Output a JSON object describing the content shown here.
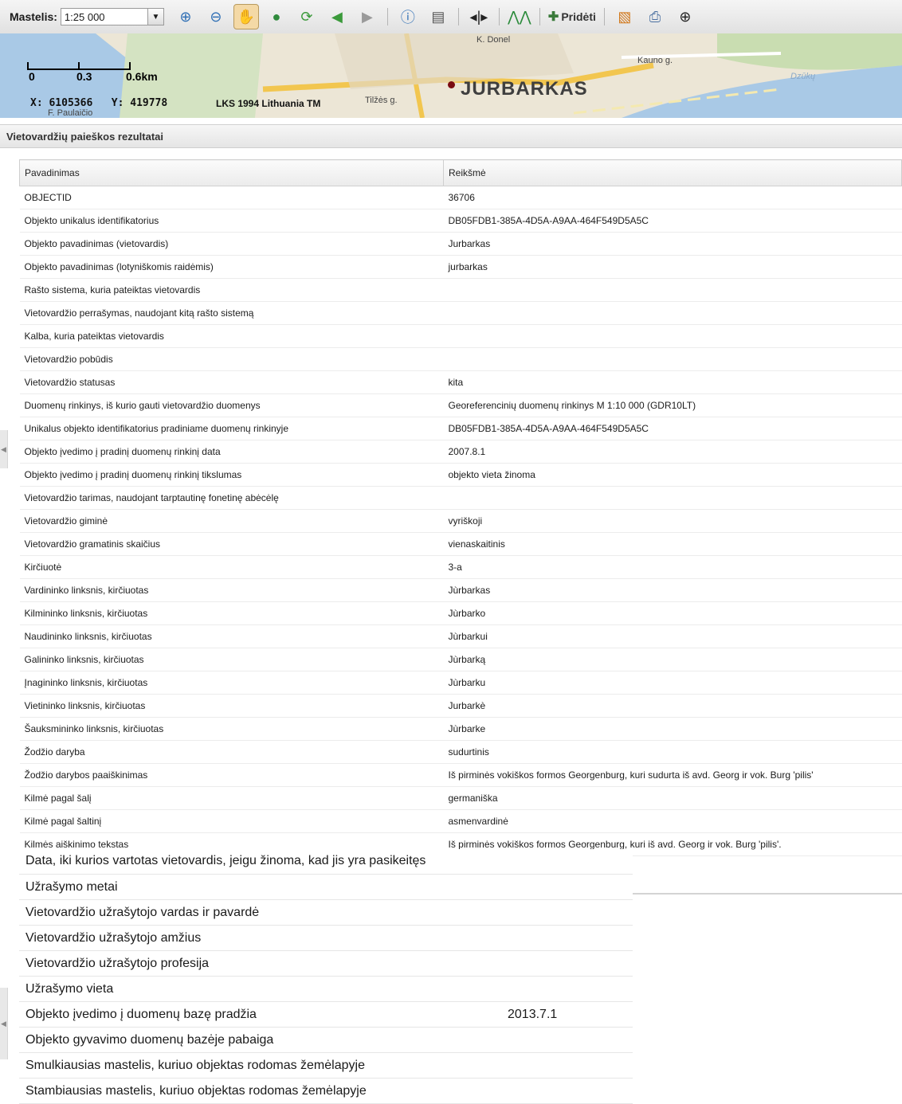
{
  "toolbar": {
    "scale_label": "Mastelis:",
    "scale_value": "1:25 000",
    "add_label": "Pridėti",
    "icons": [
      "zoom-in-icon",
      "zoom-out-icon",
      "pan-hand-icon",
      "globe-icon",
      "refresh-icon",
      "back-arrow-icon",
      "forward-arrow-icon",
      "info-icon",
      "print-icon",
      "split-view-icon",
      "elevation-profile-icon",
      "add-icon",
      "layers-icon",
      "print-map-icon",
      "locate-target-icon"
    ]
  },
  "map": {
    "town": "JURBARKAS",
    "streets": [
      "K. Donel",
      "Kauno g.",
      "Dzūkų",
      "Tilžės g.",
      "F. Paulaičio"
    ],
    "scale_ticks": [
      "0",
      "0.3",
      "0.6km"
    ],
    "coord_x_label": "X:",
    "coord_x": "6105366",
    "coord_y_label": "Y:",
    "coord_y": "419778",
    "projection": "LKS 1994 Lithuania TM"
  },
  "panel": {
    "title": "Vietovardžių paieškos rezultatai",
    "col_name": "Pavadinimas",
    "col_value": "Reikšmė",
    "rows": [
      {
        "k": "OBJECTID",
        "v": "36706"
      },
      {
        "k": "Objekto unikalus identifikatorius",
        "v": "DB05FDB1-385A-4D5A-A9AA-464F549D5A5C"
      },
      {
        "k": "Objekto pavadinimas (vietovardis)",
        "v": "Jurbarkas"
      },
      {
        "k": "Objekto pavadinimas (lotyniškomis raidėmis)",
        "v": "jurbarkas"
      },
      {
        "k": "Rašto sistema, kuria pateiktas vietovardis",
        "v": ""
      },
      {
        "k": "Vietovardžio perrašymas, naudojant kitą rašto sistemą",
        "v": ""
      },
      {
        "k": "Kalba, kuria pateiktas vietovardis",
        "v": ""
      },
      {
        "k": "Vietovardžio pobūdis",
        "v": ""
      },
      {
        "k": "Vietovardžio statusas",
        "v": "kita"
      },
      {
        "k": "Duomenų rinkinys, iš kurio gauti vietovardžio duomenys",
        "v": "Georeferencinių duomenų rinkinys M 1:10 000 (GDR10LT)"
      },
      {
        "k": "Unikalus objekto identifikatorius pradiniame duomenų rinkinyje",
        "v": "DB05FDB1-385A-4D5A-A9AA-464F549D5A5C"
      },
      {
        "k": "Objekto įvedimo į pradinį duomenų rinkinį data",
        "v": "2007.8.1"
      },
      {
        "k": "Objekto įvedimo į pradinį duomenų rinkinį tikslumas",
        "v": "objekto vieta žinoma"
      },
      {
        "k": "Vietovardžio tarimas, naudojant tarptautinę fonetinę abėcėlę",
        "v": ""
      },
      {
        "k": "Vietovardžio giminė",
        "v": "vyriškoji"
      },
      {
        "k": "Vietovardžio gramatinis skaičius",
        "v": "vienaskaitinis"
      },
      {
        "k": "Kirčiuotė",
        "v": "3-a"
      },
      {
        "k": "Vardininko linksnis, kirčiuotas",
        "v": "Jùrbarkas"
      },
      {
        "k": "Kilmininko linksnis, kirčiuotas",
        "v": "Jùrbarko"
      },
      {
        "k": "Naudininko linksnis, kirčiuotas",
        "v": "Jùrbarkui"
      },
      {
        "k": "Galininko linksnis, kirčiuotas",
        "v": "Jùrbarką"
      },
      {
        "k": "Įnagininko linksnis, kirčiuotas",
        "v": "Jùrbarku"
      },
      {
        "k": "Vietininko linksnis, kirčiuotas",
        "v": "Jurbarkè"
      },
      {
        "k": "Šauksmininko linksnis, kirčiuotas",
        "v": "Jùrbarke"
      },
      {
        "k": "Žodžio daryba",
        "v": "sudurtinis"
      },
      {
        "k": "Žodžio darybos paaiškinimas",
        "v": "Iš pirminės vokiškos formos Georgenburg, kuri sudurta iš avd. Georg ir vok. Burg 'pilis'"
      },
      {
        "k": "Kilmė pagal šalį",
        "v": "germaniška"
      },
      {
        "k": "Kilmė pagal šaltinį",
        "v": "asmenvardinė"
      },
      {
        "k": "Kilmės aiškinimo tekstas",
        "v": "Iš pirminės vokiškos formos Georgenburg, kuri iš avd. Georg ir vok. Burg 'pilis'."
      }
    ],
    "overlay_rows": [
      {
        "k": "Data, iki kurios vartotas vietovardis, jeigu žinoma, kad jis yra pasikeitęs",
        "v": ""
      },
      {
        "k": "Užrašymo metai",
        "v": ""
      },
      {
        "k": "Vietovardžio užrašytojo vardas ir pavardė",
        "v": ""
      },
      {
        "k": "Vietovardžio užrašytojo amžius",
        "v": ""
      },
      {
        "k": "Vietovardžio užrašytojo profesija",
        "v": ""
      },
      {
        "k": "Užrašymo vieta",
        "v": ""
      },
      {
        "k": "Objekto įvedimo į duomenų bazę pradžia",
        "v": "2013.7.1"
      },
      {
        "k": "Objekto gyvavimo duomenų bazėje pabaiga",
        "v": ""
      },
      {
        "k": "Smulkiausias mastelis, kuriuo objektas rodomas žemėlapyje",
        "v": ""
      },
      {
        "k": "Stambiausias mastelis, kuriuo objektas rodomas žemėlapyje",
        "v": ""
      }
    ]
  }
}
